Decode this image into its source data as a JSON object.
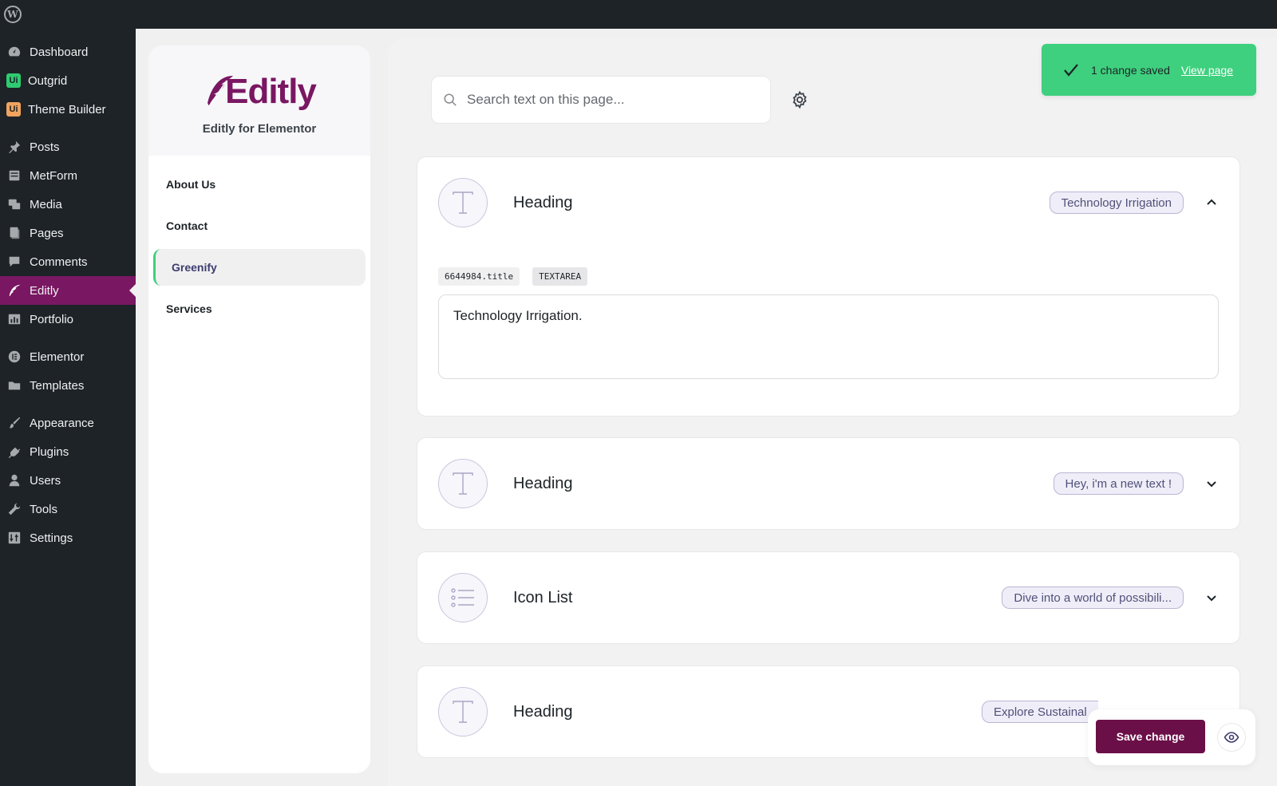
{
  "admin_menu": [
    {
      "label": "Dashboard",
      "icon": "dashboard-icon"
    },
    {
      "label": "Outgrid",
      "icon": "outgrid-icon"
    },
    {
      "label": "Theme Builder",
      "icon": "theme-builder-icon"
    },
    {
      "label": "Posts",
      "icon": "pin-icon"
    },
    {
      "label": "MetForm",
      "icon": "form-icon"
    },
    {
      "label": "Media",
      "icon": "media-icon"
    },
    {
      "label": "Pages",
      "icon": "pages-icon"
    },
    {
      "label": "Comments",
      "icon": "comment-icon"
    },
    {
      "label": "Editly",
      "icon": "quill-icon",
      "active": true
    },
    {
      "label": "Portfolio",
      "icon": "portfolio-icon"
    },
    {
      "label": "Elementor",
      "icon": "elementor-icon"
    },
    {
      "label": "Templates",
      "icon": "folder-icon"
    },
    {
      "label": "Appearance",
      "icon": "brush-icon"
    },
    {
      "label": "Plugins",
      "icon": "plug-icon"
    },
    {
      "label": "Users",
      "icon": "user-icon"
    },
    {
      "label": "Tools",
      "icon": "wrench-icon"
    },
    {
      "label": "Settings",
      "icon": "settings-icon"
    }
  ],
  "badges": {
    "outgrid": "Ui",
    "theme_builder": "Ui"
  },
  "brand": {
    "logo_text": "Editly",
    "subtitle": "Editly for Elementor"
  },
  "pages": [
    {
      "label": "About Us"
    },
    {
      "label": "Contact"
    },
    {
      "label": "Greenify",
      "active": true
    },
    {
      "label": "Services"
    }
  ],
  "search": {
    "placeholder": "Search text on this page..."
  },
  "toast": {
    "message": "1 change saved",
    "link": "View page"
  },
  "cards": [
    {
      "title": "Heading",
      "preview": "Technology Irrigation",
      "expanded": true,
      "field_id": "6644984.title",
      "field_type": "TEXTAREA",
      "value": "Technology Irrigation.",
      "icon": "heading-t-icon"
    },
    {
      "title": "Heading",
      "preview": "Hey, i'm a new text !",
      "expanded": false,
      "icon": "heading-t-icon"
    },
    {
      "title": "Icon List",
      "preview": "Dive into a world of possibili...",
      "expanded": false,
      "icon": "list-icon"
    },
    {
      "title": "Heading",
      "preview": "Explore Sustainal",
      "expanded": false,
      "icon": "heading-t-icon"
    }
  ],
  "actions": {
    "save_label": "Save change"
  },
  "colors": {
    "admin_bg": "#1d2327",
    "brand": "#7a1762",
    "save_btn": "#6b0f48",
    "toast": "#3ed07e",
    "active_page_border": "#3ed07e"
  }
}
